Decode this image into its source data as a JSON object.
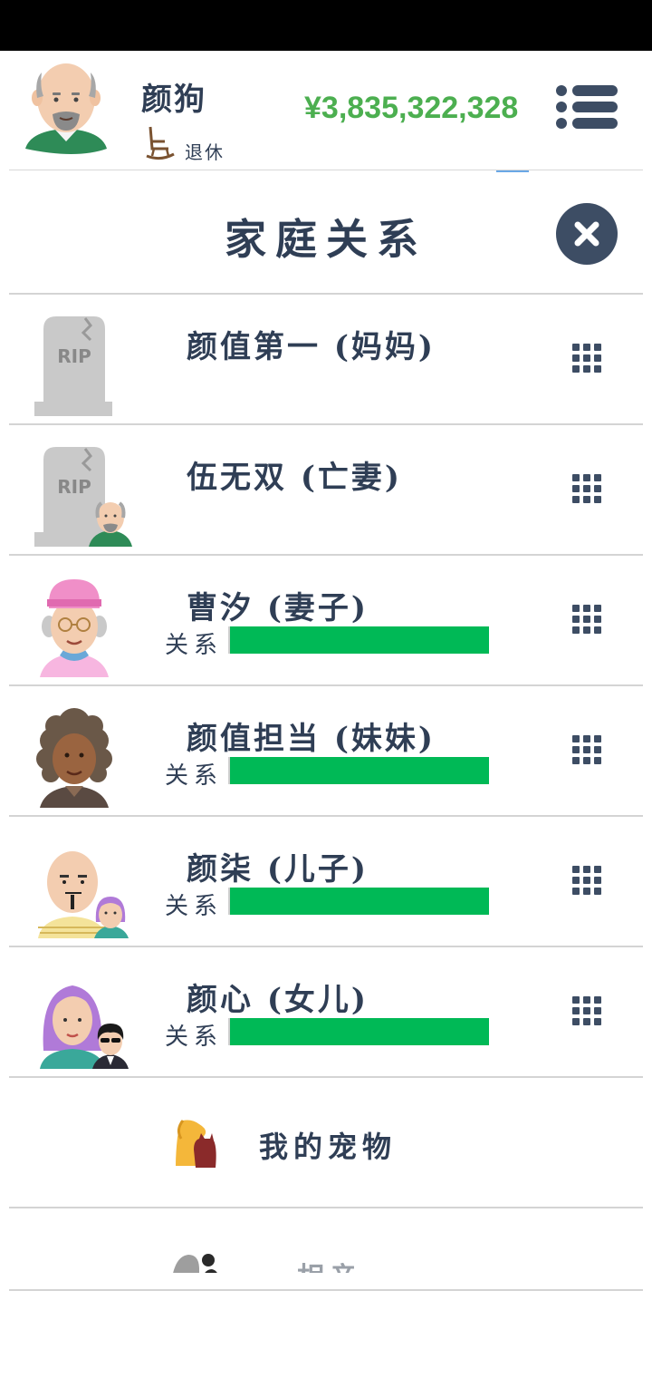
{
  "header": {
    "player_name": "颜狗",
    "status": "退休",
    "money": "¥3,835,322,328"
  },
  "panel": {
    "title": "家庭关系"
  },
  "relationship_label": "关系",
  "relatives": [
    {
      "name": "颜值第一 (妈妈)",
      "deceased": true,
      "relationship": null,
      "avatar": "tombstone-icon"
    },
    {
      "name": "伍无双 (亡妻)",
      "deceased": true,
      "relationship": null,
      "avatar": "tombstone-with-old-man-icon"
    },
    {
      "name": "曹汐 (妻子)",
      "deceased": false,
      "relationship": 1.0,
      "avatar": "old-woman-pink-hat-avatar"
    },
    {
      "name": "颜值担当 (妹妹)",
      "deceased": false,
      "relationship": 1.0,
      "avatar": "curly-hair-woman-avatar"
    },
    {
      "name": "颜柒 (儿子)",
      "deceased": false,
      "relationship": 1.0,
      "avatar": "bald-man-with-child-avatar"
    },
    {
      "name": "颜心 (女儿)",
      "deceased": false,
      "relationship": 1.0,
      "avatar": "purple-hair-woman-with-child-avatar"
    }
  ],
  "pets": {
    "label": "我的宠物"
  },
  "next_section": {
    "label": "相亲"
  },
  "colors": {
    "accent_money": "#4caf50",
    "relationship_bar": "#00b956",
    "text": "#2f3e55",
    "close_button": "#3d4d64"
  },
  "rip_text": "RIP"
}
